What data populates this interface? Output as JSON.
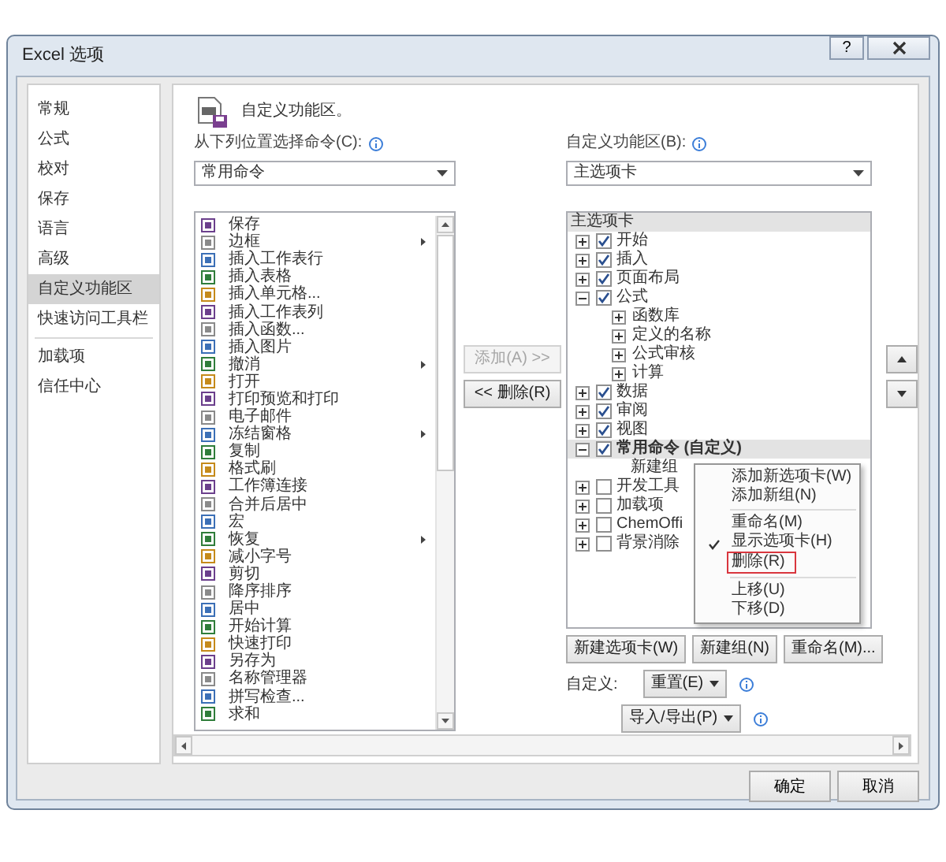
{
  "window": {
    "title": "Excel 选项",
    "help_button": "?"
  },
  "sidebar": {
    "items": [
      {
        "label": "常规",
        "selected": false
      },
      {
        "label": "公式",
        "selected": false
      },
      {
        "label": "校对",
        "selected": false
      },
      {
        "label": "保存",
        "selected": false
      },
      {
        "label": "语言",
        "selected": false
      },
      {
        "label": "高级",
        "selected": false
      },
      {
        "label": "自定义功能区",
        "selected": true
      },
      {
        "label": "快速访问工具栏",
        "selected": false,
        "divider_after": true
      },
      {
        "label": "加载项",
        "selected": false
      },
      {
        "label": "信任中心",
        "selected": false
      }
    ]
  },
  "heading": "自定义功能区。",
  "commands": {
    "label": "从下列位置选择命令(C):",
    "dropdown": "常用命令",
    "items": [
      {
        "label": "保存",
        "submenu": false
      },
      {
        "label": "边框",
        "submenu": true
      },
      {
        "label": "插入工作表行",
        "submenu": false
      },
      {
        "label": "插入表格",
        "submenu": false
      },
      {
        "label": "插入单元格...",
        "submenu": false
      },
      {
        "label": "插入工作表列",
        "submenu": false
      },
      {
        "label": "插入函数...",
        "submenu": false
      },
      {
        "label": "插入图片",
        "submenu": false
      },
      {
        "label": "撤消",
        "submenu": true
      },
      {
        "label": "打开",
        "submenu": false
      },
      {
        "label": "打印预览和打印",
        "submenu": false
      },
      {
        "label": "电子邮件",
        "submenu": false
      },
      {
        "label": "冻结窗格",
        "submenu": true
      },
      {
        "label": "复制",
        "submenu": false
      },
      {
        "label": "格式刷",
        "submenu": false
      },
      {
        "label": "工作簿连接",
        "submenu": false
      },
      {
        "label": "合并后居中",
        "submenu": false
      },
      {
        "label": "宏",
        "submenu": false
      },
      {
        "label": "恢复",
        "submenu": true
      },
      {
        "label": "减小字号",
        "submenu": false
      },
      {
        "label": "剪切",
        "submenu": false
      },
      {
        "label": "降序排序",
        "submenu": false
      },
      {
        "label": "居中",
        "submenu": false
      },
      {
        "label": "开始计算",
        "submenu": false
      },
      {
        "label": "快速打印",
        "submenu": false
      },
      {
        "label": "另存为",
        "submenu": false
      },
      {
        "label": "名称管理器",
        "submenu": false
      },
      {
        "label": "拼写检查...",
        "submenu": false
      },
      {
        "label": "求和",
        "submenu": false
      }
    ]
  },
  "middle_buttons": [
    {
      "label": "添加(A) >>",
      "disabled": true
    },
    {
      "label": "<< 删除(R)",
      "disabled": false
    }
  ],
  "ribbon": {
    "label": "自定义功能区(B):",
    "dropdown": "主选项卡",
    "tree_header": "主选项卡",
    "items": [
      {
        "label": "开始",
        "checked": true,
        "expanded": false,
        "selected": false
      },
      {
        "label": "插入",
        "checked": true,
        "expanded": false,
        "selected": false
      },
      {
        "label": "页面布局",
        "checked": true,
        "expanded": false,
        "selected": false
      },
      {
        "label": "公式",
        "checked": true,
        "expanded": true,
        "selected": false,
        "children": [
          {
            "label": "函数库",
            "expanded": false
          },
          {
            "label": "定义的名称",
            "expanded": false
          },
          {
            "label": "公式审核",
            "expanded": false
          },
          {
            "label": "计算",
            "expanded": false
          }
        ]
      },
      {
        "label": "数据",
        "checked": true,
        "expanded": false,
        "selected": false
      },
      {
        "label": "审阅",
        "checked": true,
        "expanded": false,
        "selected": false
      },
      {
        "label": "视图",
        "checked": true,
        "expanded": false,
        "selected": false
      },
      {
        "label": "常用命令 (自定义)",
        "checked": true,
        "expanded": true,
        "selected": true,
        "children": [
          {
            "label": "新建组"
          }
        ]
      },
      {
        "label": "开发工具",
        "checked": false,
        "expanded": false,
        "selected": false
      },
      {
        "label": "加载项",
        "checked": false,
        "expanded": false,
        "selected": false
      },
      {
        "label": "ChemOffi",
        "checked": false,
        "expanded": false,
        "selected": false
      },
      {
        "label": "背景消除",
        "checked": false,
        "expanded": false,
        "selected": false
      }
    ],
    "buttons": [
      "新建选项卡(W)",
      "新建组(N)",
      "重命名(M)..."
    ],
    "customize_label": "自定义:",
    "reset_button": "重置(E)",
    "import_export_button": "导入/导出(P)"
  },
  "context_menu": [
    {
      "kind": "item",
      "label": "添加新选项卡(W)",
      "checked": false,
      "selected": false
    },
    {
      "kind": "item",
      "label": "添加新组(N)",
      "checked": false,
      "selected": false
    },
    {
      "kind": "separator"
    },
    {
      "kind": "item",
      "label": "重命名(M)",
      "checked": false,
      "selected": false
    },
    {
      "kind": "item",
      "label": "显示选项卡(H)",
      "checked": true,
      "selected": false
    },
    {
      "kind": "item",
      "label": "删除(R)",
      "checked": false,
      "selected": true
    },
    {
      "kind": "separator"
    },
    {
      "kind": "item",
      "label": "上移(U)",
      "checked": false,
      "selected": false
    },
    {
      "kind": "item",
      "label": "下移(D)",
      "checked": false,
      "selected": false
    }
  ],
  "footer_buttons": [
    "确定",
    "取消"
  ]
}
